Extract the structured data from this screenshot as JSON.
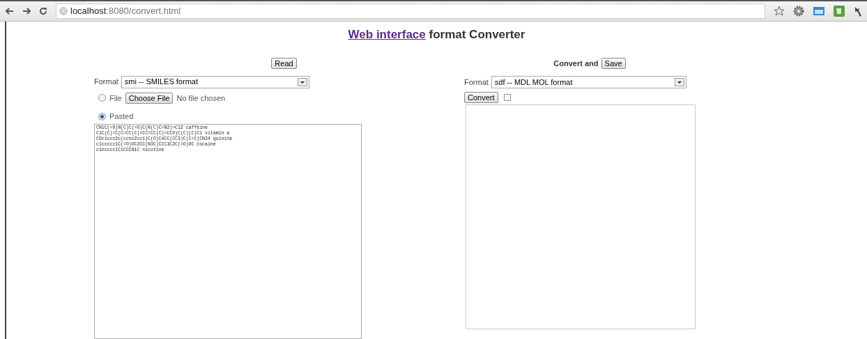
{
  "browser": {
    "url_host": "localhost",
    "url_rest": ":8080/convert.html"
  },
  "heading": {
    "link": "Web interface",
    "rest": "format Converter"
  },
  "input_panel": {
    "read_button": "Read",
    "format_label": "Format",
    "format_value": "smi -- SMILES format",
    "sources": [
      {
        "kind": "file",
        "label": "File",
        "selected": false,
        "button": "Choose File",
        "status": "No file chosen"
      },
      {
        "kind": "pasted",
        "label": "Pasted",
        "selected": true
      }
    ],
    "pasted_text": "CN1C(=O)N(C)C(=O)C(N(C)C=N2)=C12 caffeine\nC1C(C)=C(C=CC(C)=CC=CC(C)=CCO)C(C)(C)C1 vitamin a\nCOc1ccc2c(ccnc2cc1)C(O)C4CC(CC3)C(C=C)CN34 quinine\nc1ccccc1C(=O)OC2CC(N3C)CCC3C2C(=O)OC cocaine\nc1ncccc1C1CCCN1C nicotine"
  },
  "output_panel": {
    "label": "Convert and",
    "save_button": "Save",
    "format_label": "Format",
    "format_value": "sdf -- MDL MOL format",
    "convert_button": "Convert",
    "checked": false
  }
}
